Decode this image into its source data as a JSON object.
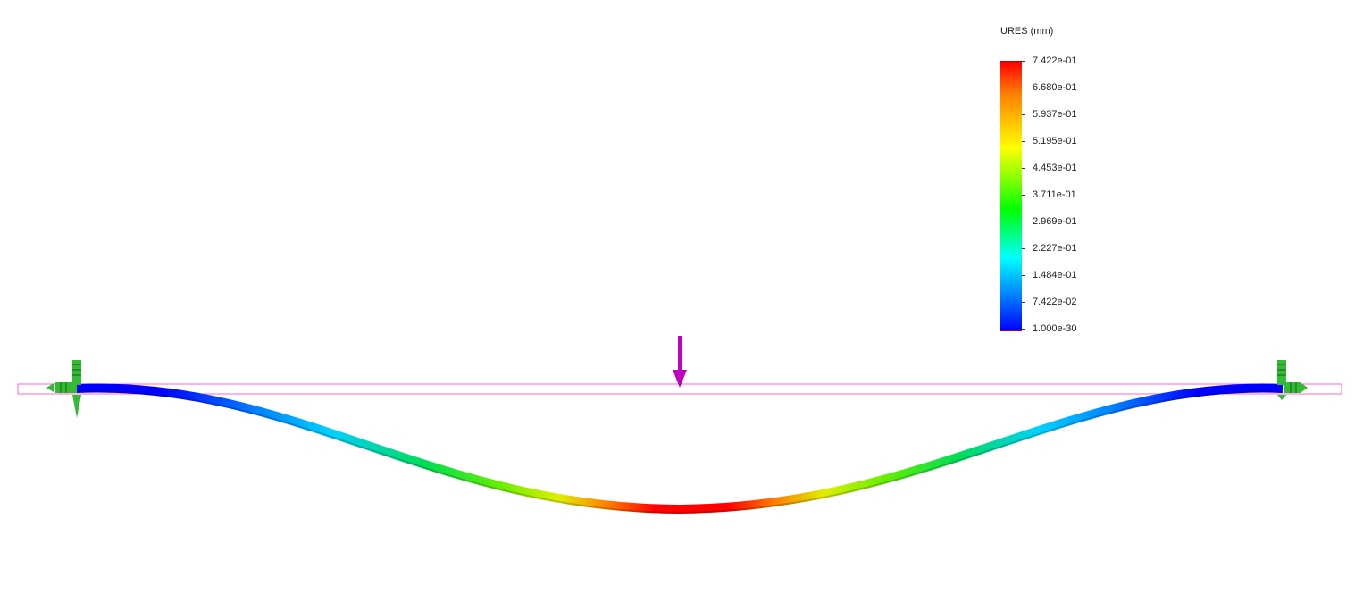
{
  "legend": {
    "title": "URES (mm)",
    "labels": [
      "7.422e-01",
      "6.680e-01",
      "5.937e-01",
      "5.195e-01",
      "4.453e-01",
      "3.711e-01",
      "2.969e-01",
      "2.227e-01",
      "1.484e-01",
      "7.422e-02",
      "1.000e-30"
    ],
    "colors": [
      "#ff0000",
      "#ff8000",
      "#ffff00",
      "#80ff00",
      "#00ff00",
      "#00ffff",
      "#0080ff",
      "#0000ff"
    ]
  },
  "result": {
    "max_displacement_mm": 0.7422,
    "min_displacement_mm": 1e-30
  },
  "colors": {
    "undeformed_outline": "#ff66cc",
    "load_arrow": "#c000c0",
    "fixture": "#22aa22"
  }
}
